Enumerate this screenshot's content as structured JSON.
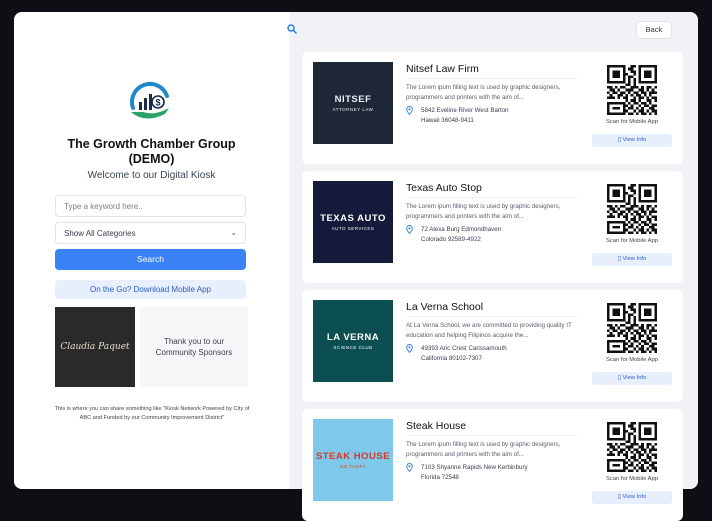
{
  "sidebar": {
    "org_title": "The Growth Chamber Group (DEMO)",
    "welcome": "Welcome to our Digital Kiosk",
    "search_placeholder": "Type a keyword here..",
    "category_selected": "Show All Categories",
    "search_label": "Search",
    "download_label": "On the Go? Download Mobile App",
    "sponsor_logo_text": "Claudia Paquet",
    "sponsor_thanks": "Thank you to our Community Sponsors",
    "footer_note": "This is where you can share something like \"Kiosk Network Powered by City of ABC and Funded by our Community Improvement District\""
  },
  "header": {
    "back_label": "Back"
  },
  "listings": [
    {
      "title": "Nitsef Law Firm",
      "desc": "The Lorem ipum filling text is used by graphic designers, programmers and printers with the aim of...",
      "addr1": "5842 Eveline River West Barton",
      "addr2": "Hawaii 36048-9411",
      "img_text": "NITSEF",
      "img_sub": "ATTORNEY LAW",
      "scan_label": "Scan for Mobile App",
      "view_label": "View Info"
    },
    {
      "title": "Texas Auto Stop",
      "desc": "The Lorem ipum filling text is used by graphic designers, programmers and printers with the aim of...",
      "addr1": "72 Alexa Burg Edmondhaven",
      "addr2": "Colorado 92589-4922",
      "img_text": "TEXAS AUTO",
      "img_sub": "AUTO SERVICES",
      "scan_label": "Scan for Mobile App",
      "view_label": "View Info"
    },
    {
      "title": "La Verna School",
      "desc": "At La Verna School, we are committed to providing quality IT education and helping Filipinos acquire the...",
      "addr1": "49393 Aric Crest Carissamouth",
      "addr2": "California 80102-7307",
      "img_text": "LA VERNA",
      "img_sub": "SCIENCE CLUB",
      "scan_label": "Scan for Mobile App",
      "view_label": "View Info"
    },
    {
      "title": "Steak House",
      "desc": "The Lorem ipum filling text is used by graphic designers, programmers and printers with the aim of...",
      "addr1": "7103 Shyanne Rapids New Kerbinbury",
      "addr2": "Florida 72548",
      "img_text": "STEAK HOUSE",
      "img_sub": "SO TASTY",
      "scan_label": "Scan for Mobile App",
      "view_label": "View Info"
    }
  ],
  "colors": {
    "accent": "#3b82f6",
    "panel_bg": "#f1f2f5"
  },
  "icons": {
    "search": "search-icon",
    "pin": "location-pin-icon",
    "phone": "phone-icon",
    "chevron": "chevron-down-icon"
  }
}
